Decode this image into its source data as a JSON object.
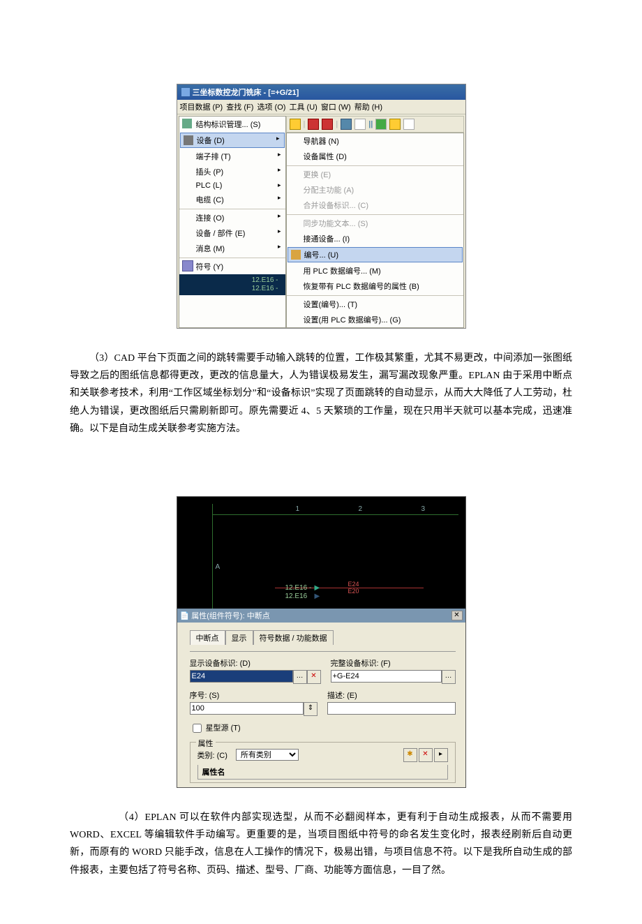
{
  "screenshot1": {
    "title": "三坐标数控龙门铣床 - [=+G/21]",
    "menubar": [
      "项目数据 (P)",
      "查找 (F)",
      "选项 (O)",
      "工具 (U)",
      "窗口 (W)",
      "帮助 (H)"
    ],
    "left_menu": {
      "top": "结构标识管理... (S)",
      "items": [
        {
          "label": "设备 (D)",
          "sub": true,
          "hl": true
        },
        {
          "label": "端子排 (T)",
          "sub": true
        },
        {
          "label": "插头 (P)",
          "sub": true
        },
        {
          "label": "PLC (L)",
          "sub": true
        },
        {
          "label": "电缆 (C)",
          "sub": true
        },
        {
          "label": "连接 (O)",
          "sub": true,
          "sep": true
        },
        {
          "label": "设备 / 部件 (E)",
          "sub": true
        },
        {
          "label": "消息 (M)",
          "sub": true
        },
        {
          "label": "符号 (Y)",
          "sub": false,
          "sep": true,
          "icon": "icon-sym"
        }
      ]
    },
    "right_menu": [
      {
        "label": "导航器 (N)"
      },
      {
        "label": "设备属性 (D)"
      },
      {
        "label": "更换 (E)",
        "dis": true,
        "sep": true
      },
      {
        "label": "分配主功能 (A)",
        "dis": true
      },
      {
        "label": "合并设备标识... (C)",
        "dis": true
      },
      {
        "label": "同步功能文本... (S)",
        "dis": true,
        "sep": true
      },
      {
        "label": "接通设备... (I)"
      },
      {
        "label": "编号... (U)",
        "hl": true,
        "sep": true,
        "icon": "icon-num"
      },
      {
        "label": "用 PLC 数据编号... (M)"
      },
      {
        "label": "恢复带有 PLC 数据编号的属性 (B)"
      },
      {
        "label": "设置(编号)... (T)",
        "sep": true
      },
      {
        "label": "设置(用 PLC 数据编号)... (G)"
      }
    ],
    "ref": {
      "a": "12.E16 -",
      "b": "12.E16 -"
    }
  },
  "para3": "（3）CAD 平台下页面之间的跳转需要手动输入跳转的位置，工作极其繁重，尤其不易更改，中间添加一张图纸导致之后的图纸信息都得更改，更改的信息量大，人为错误极易发生，漏写漏改现象严重。EPLAN 由于采用中断点和关联参考技术，利用“工作区域坐标划分”和“设备标识”实现了页面跳转的自动显示，从而大大降低了人工劳动，杜绝人为错误，更改图纸后只需刷新即可。原先需要近 4、5 天繁琐的工作量，现在只用半天就可以基本完成，迅速准确。以下是自动生成关联参考实施方法。",
  "screenshot2": {
    "ticks": [
      "1",
      "2",
      "3"
    ],
    "rowA": "A",
    "ref1": "12.E16 -",
    "ref2": "12.E16",
    "reflabel1": "E24",
    "reflabel2": "E20",
    "dialog_title": "属性(组件符号): 中断点",
    "tabs": [
      "中断点",
      "显示",
      "符号数据 / 功能数据"
    ],
    "fields": {
      "display_id_label": "显示设备标识: (D)",
      "display_id_value": "E24",
      "full_id_label": "完整设备标识: (F)",
      "full_id_value": "+G-E24",
      "seq_label": "序号: (S)",
      "seq_value": "100",
      "desc_label": "描述: (E)",
      "desc_value": ""
    },
    "star_label": "星型源 (T)",
    "group_legend": "属性",
    "category_label": "类别: (C)",
    "category_value": "所有类别",
    "prop_header": "属性名"
  },
  "para4": "（4）EPLAN 可以在软件内部实现选型，从而不必翻阅样本，更有利于自动生成报表，从而不需要用 WORD、EXCEL 等编辑软件手动编写。更重要的是，当项目图纸中符号的命名发生变化时，报表经刷新后自动更新，而原有的 WORD 只能手改，信息在人工操作的情况下，极易出错，与项目信息不符。以下是我所自动生成的部件报表，主要包括了符号名称、页码、描述、型号、厂商、功能等方面信息，一目了然。"
}
